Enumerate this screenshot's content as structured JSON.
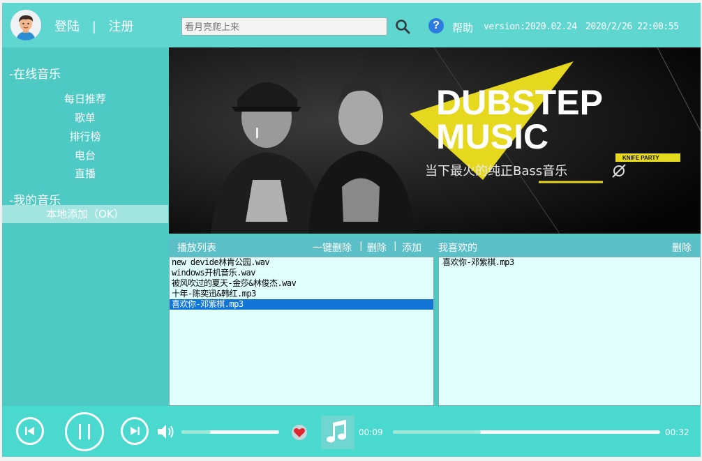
{
  "header": {
    "login_label": "登陆",
    "separator": "|",
    "register_label": "注册",
    "search_placeholder": "看月亮爬上来",
    "help_label": "帮助",
    "version": "version:2020.02.24",
    "datetime": "2020/2/26 22:00:55"
  },
  "sidebar": {
    "online_title": "-在线音乐",
    "online_items": [
      "每日推荐",
      "歌单",
      "排行榜",
      "电台",
      "直播"
    ],
    "my_title": "-我的音乐",
    "my_items": [
      "本地添加（OK）"
    ]
  },
  "banner": {
    "title_line1": "DUBSTEP",
    "title_line2": "MUSIC",
    "tag": "KNIFE PARTY",
    "subtitle": "当下最火的纯正Bass音乐"
  },
  "playlist": {
    "title": "播放列表",
    "clear_all_label": "一键删除",
    "delete_label": "删除",
    "add_label": "添加",
    "sep": "|",
    "items": [
      "new devide林肯公园.wav",
      "windows开机音乐.wav",
      "被风吹过的夏天-金莎&林俊杰.wav",
      "十年-陈奕迅&韩红.mp3",
      "喜欢你-邓紫棋.mp3"
    ],
    "selected_index": 4
  },
  "favorites": {
    "title": "我喜欢的",
    "delete_label": "删除",
    "items": [
      "喜欢你-邓紫棋.mp3"
    ]
  },
  "player": {
    "current_time": "00:09",
    "total_time": "00:32",
    "volume_fraction": 0.3,
    "progress_fraction": 0.33,
    "colors": {
      "accent": "#4ad9cf",
      "heart": "#e0262f",
      "selection": "#1176d6"
    }
  }
}
